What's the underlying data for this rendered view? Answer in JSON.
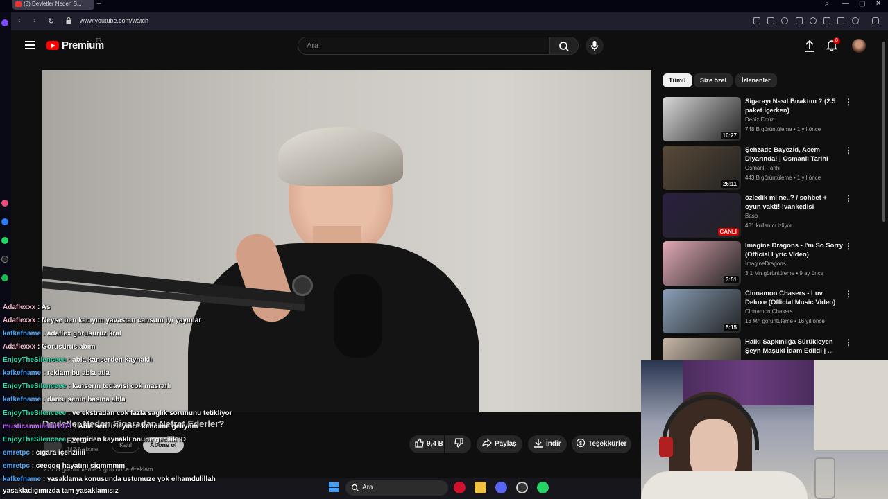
{
  "browser": {
    "tab_title": "(8) Devletler Neden S...",
    "url": "www.youtube.com/watch"
  },
  "header": {
    "logo_text": "Premium",
    "logo_tr": "TR",
    "search_placeholder": "Ara",
    "notification_count": "8"
  },
  "video": {
    "title": "Devletler Neden Sigaradan Nefret Ederler?",
    "channel": "FΣver",
    "subscribers": "142 B abone",
    "join_label": "Katıl",
    "subscribe_label": "Abone ol",
    "likes": "9,4 B",
    "share_label": "Paylaş",
    "download_label": "İndir",
    "thanks_label": "Teşekkürler",
    "views_line": "227 B görüntüleme  1 gün önce  #reklam"
  },
  "chips": [
    {
      "label": "Tümü",
      "active": true
    },
    {
      "label": "Size özel",
      "active": false
    },
    {
      "label": "İzlenenler",
      "active": false
    }
  ],
  "recommendations": [
    {
      "title": "Sigarayı Nasıl Bıraktım ? (2.5 paket içerken)",
      "channel": "Deniz Ertüz",
      "meta": "748 B görüntüleme • 1 yıl önce",
      "duration": "10:27",
      "thumb_color": "#d8d8d8"
    },
    {
      "title": "Şehzade Bayezid, Acem Diyarında! | Osmanlı Tarihi",
      "channel": "Osmanlı Tarihi",
      "meta": "443 B görüntüleme • 1 yıl önce",
      "duration": "26:11",
      "thumb_color": "#5a4a38"
    },
    {
      "title": "özledik mi ne..? / sohbet + oyun vakti! !vankedisi",
      "channel": "Baso",
      "meta": "431 kullanıcı izliyor",
      "duration": "CANLI",
      "thumb_color": "#2a2040"
    },
    {
      "title": "Imagine Dragons - I'm So Sorry (Official Lyric Video)",
      "channel": "ImagineDragons",
      "meta": "3,1 Mn görüntüleme • 9 ay önce",
      "duration": "3:51",
      "thumb_color": "#e0a8b4"
    },
    {
      "title": "Cinnamon Chasers - Luv Deluxe (Official Music Video)",
      "channel": "Cinnamon Chasers",
      "meta": "13 Mn görüntüleme • 16 yıl önce",
      "duration": "5:15",
      "thumb_color": "#8aa0b8"
    },
    {
      "title": "Halkı Sapkınlığa Sürükleyen Şeyh Maşuki İdam Edildi | ...",
      "channel": "",
      "meta": "",
      "duration": "",
      "thumb_color": "#c8b8a8"
    }
  ],
  "chat": [
    {
      "user": "Adaflexxx",
      "color": "#f0b8c8",
      "text": ": As"
    },
    {
      "user": "Adaflexxx",
      "color": "#f0b8c8",
      "text": ": Neyse ben kacıyım yavastan cansum iyi yayınlar"
    },
    {
      "user": "kafkefname",
      "color": "#4aa8ff",
      "text": ": adaflex gorusuruz kral"
    },
    {
      "user": "Adaflexxx",
      "color": "#f0b8c8",
      "text": ": Gorusurus abim"
    },
    {
      "user": "EnjoyTheSilenceee",
      "color": "#2ee0b0",
      "text": ": abla kanserden kaynaklı"
    },
    {
      "user": "kafkefname",
      "color": "#4aa8ff",
      "text": ": reklam bu abla atla"
    },
    {
      "user": "EnjoyTheSilenceee",
      "color": "#2ee0b0",
      "text": ": kanserın tedavisi cok masraflı"
    },
    {
      "user": "kafkefname",
      "color": "#4aa8ff",
      "text": ": darısı senin basına abla"
    },
    {
      "user": "EnjoyTheSilenceee",
      "color": "#2ee0b0",
      "text": ": ve ekstradan cok fazla saglık sorununu tetikliyor"
    },
    {
      "user": "musticanmiiiiiiiii1971",
      "color": "#c26cff",
      "text": ": Abla seni izleyince kendime geliyom"
    },
    {
      "user": "EnjoyTheSilenceee",
      "color": "#2ee0b0",
      "text": ": vergiden kaynaklı onune gecilik :D"
    },
    {
      "user": "emretpc",
      "color": "#4aa8ff",
      "text": ": cıgara içenziiiii"
    },
    {
      "user": "emretpc",
      "color": "#4aa8ff",
      "text": ": ceeqqq hayatını sigmmmm"
    },
    {
      "user": "kafkefname",
      "color": "#4aa8ff",
      "text": ": yasaklama konusunda ustumuze yok elhamdulillah"
    },
    {
      "user": "",
      "color": "#ffffff",
      "text": "yasakladıgımızda tam yasaklamısız"
    }
  ],
  "taskbar": {
    "search_label": "Ara"
  }
}
